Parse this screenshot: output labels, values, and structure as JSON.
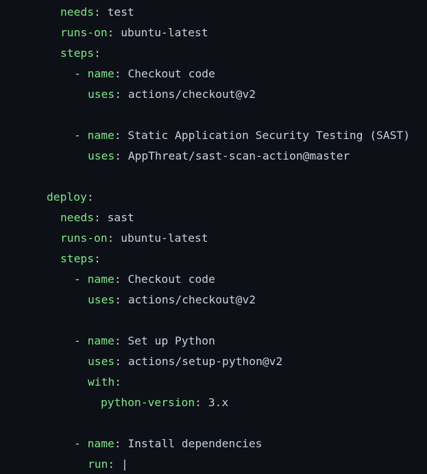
{
  "code": {
    "lines": [
      {
        "dash": "",
        "key": "needs",
        "sep": ": ",
        "value": "test"
      },
      {
        "dash": "",
        "key": "runs-on",
        "sep": ": ",
        "value": "ubuntu-latest"
      },
      {
        "dash": "",
        "key": "steps",
        "sep": ":",
        "value": ""
      },
      {
        "dash": "- ",
        "key": "name",
        "sep": ": ",
        "value": "Checkout code"
      },
      {
        "dash": "",
        "key": "uses",
        "sep": ": ",
        "value": "actions/checkout@v2"
      },
      {
        "dash": "",
        "key": "",
        "sep": "",
        "value": ""
      },
      {
        "dash": "- ",
        "key": "name",
        "sep": ": ",
        "value": "Static Application Security Testing (SAST)"
      },
      {
        "dash": "",
        "key": "uses",
        "sep": ": ",
        "value": "AppThreat/sast-scan-action@master"
      },
      {
        "dash": "",
        "key": "",
        "sep": "",
        "value": ""
      },
      {
        "dash": "",
        "key": "deploy",
        "sep": ":",
        "value": ""
      },
      {
        "dash": "",
        "key": "needs",
        "sep": ": ",
        "value": "sast"
      },
      {
        "dash": "",
        "key": "runs-on",
        "sep": ": ",
        "value": "ubuntu-latest"
      },
      {
        "dash": "",
        "key": "steps",
        "sep": ":",
        "value": ""
      },
      {
        "dash": "- ",
        "key": "name",
        "sep": ": ",
        "value": "Checkout code"
      },
      {
        "dash": "",
        "key": "uses",
        "sep": ": ",
        "value": "actions/checkout@v2"
      },
      {
        "dash": "",
        "key": "",
        "sep": "",
        "value": ""
      },
      {
        "dash": "- ",
        "key": "name",
        "sep": ": ",
        "value": "Set up Python"
      },
      {
        "dash": "",
        "key": "uses",
        "sep": ": ",
        "value": "actions/setup-python@v2"
      },
      {
        "dash": "",
        "key": "with",
        "sep": ":",
        "value": ""
      },
      {
        "dash": "",
        "key": "python-version",
        "sep": ": ",
        "value": "3.x"
      },
      {
        "dash": "",
        "key": "",
        "sep": "",
        "value": ""
      },
      {
        "dash": "- ",
        "key": "name",
        "sep": ": ",
        "value": "Install dependencies"
      },
      {
        "dash": "",
        "key": "run",
        "sep": ": ",
        "value": "|"
      }
    ]
  },
  "colors": {
    "background": "#0d1117",
    "key": "#7ee787",
    "text": "#c9d1d9"
  }
}
